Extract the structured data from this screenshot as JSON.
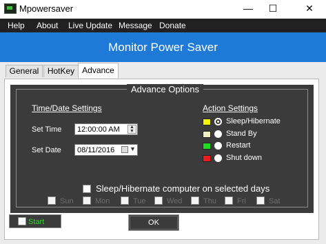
{
  "window": {
    "title": "Mpowersaver",
    "min_glyph": "—",
    "max_glyph": "☐",
    "close_glyph": "✕"
  },
  "menu": [
    "Help",
    "About",
    "Live Update",
    "Message",
    "Donate"
  ],
  "heading": "Monitor Power Saver",
  "tabs": [
    {
      "label": "General",
      "active": false
    },
    {
      "label": "HotKey",
      "active": false
    },
    {
      "label": "Advance",
      "active": true
    }
  ],
  "advance": {
    "group_title": "Advance Options",
    "time_date": {
      "title": "Time/Date Settings",
      "set_time_label": "Set Time",
      "set_time_value": "12:00:00 AM",
      "set_date_label": "Set Date",
      "set_date_value": "08/11/2016"
    },
    "actions": {
      "title": "Action Settings",
      "items": [
        {
          "label": "Sleep/Hibernate",
          "color": "#f5f500",
          "selected": true
        },
        {
          "label": "Stand By",
          "color": "#f0f0c0",
          "selected": false
        },
        {
          "label": "Restart",
          "color": "#1fdc1f",
          "selected": false
        },
        {
          "label": "Shut down",
          "color": "#ee1c1c",
          "selected": false
        }
      ]
    },
    "sleep_days_label": "Sleep/Hibernate computer on selected days",
    "days": [
      "Sun",
      "Mon",
      "Tue",
      "Wed",
      "Thu",
      "Fri",
      "Sat"
    ],
    "start_label": "Start",
    "ok_label": "OK"
  },
  "colors": {
    "accent_blue": "#1e7ad6",
    "menubar": "#212121",
    "panel_dark": "#3b3b3b",
    "start_green": "#32d232"
  }
}
